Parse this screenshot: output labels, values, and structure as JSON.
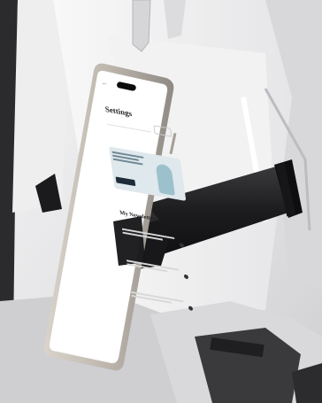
{
  "phone_screen": {
    "page_title": "Settings",
    "section_title": "My Newsletters"
  },
  "colors": {
    "seat_back": "#e6e6e8",
    "mount_black": "#1a1a1c",
    "phone_frame": "#c9c3bb",
    "screen_bg": "#ffffff"
  },
  "icons": [
    "back-arrow-icon",
    "dynamic-island-icon"
  ]
}
